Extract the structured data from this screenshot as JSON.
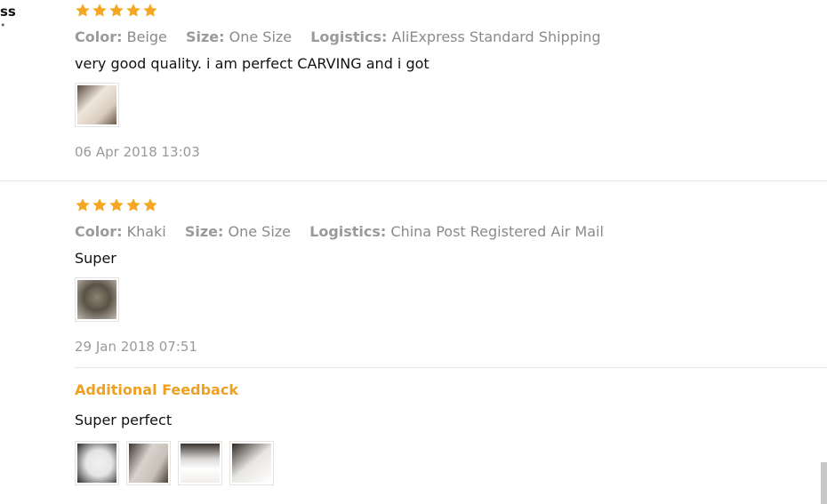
{
  "left_stub": {
    "text": "ss",
    "mark": "•"
  },
  "reviews": [
    {
      "stars": 5,
      "meta": [
        {
          "key": "Color:",
          "value": "Beige"
        },
        {
          "key": "Size:",
          "value": "One Size"
        },
        {
          "key": "Logistics:",
          "value": "AliExpress Standard Shipping"
        }
      ],
      "text": "very good quality. i am perfect CARVING and i got",
      "date": "06 Apr 2018 13:03"
    },
    {
      "stars": 5,
      "meta": [
        {
          "key": "Color:",
          "value": "Khaki"
        },
        {
          "key": "Size:",
          "value": "One Size"
        },
        {
          "key": "Logistics:",
          "value": "China Post Registered Air Mail"
        }
      ],
      "text": "Super",
      "date": "29 Jan 2018 07:51"
    }
  ],
  "additional": {
    "title": "Additional Feedback",
    "text": "Super perfect"
  },
  "colors": {
    "star": "#f5a623",
    "accent": "#f0a020",
    "meta_text": "#8a8a8a"
  },
  "icons": {
    "star": "star-icon"
  }
}
